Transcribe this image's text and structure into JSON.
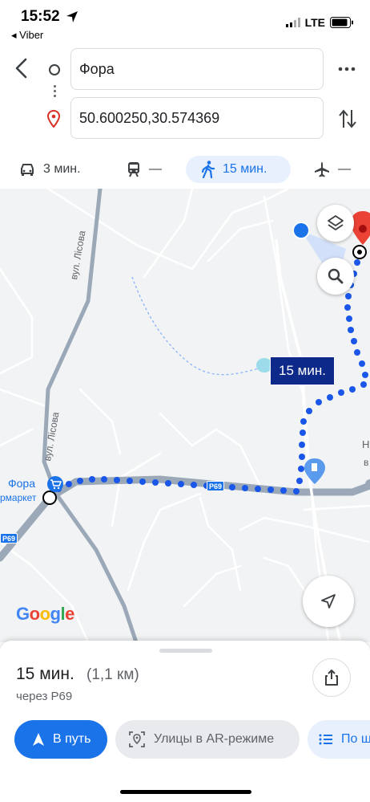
{
  "status_bar": {
    "time": "15:52",
    "back_app": "◂ Viber",
    "network": "LTE"
  },
  "search": {
    "origin": "Фора",
    "destination": "50.600250,30.574369"
  },
  "modes": {
    "car": "3 мин.",
    "transit": "—",
    "walk": "15 мин.",
    "flight": "—"
  },
  "map": {
    "road_labels": [
      "вул. Лісова",
      "вул. Лісова"
    ],
    "route_shield_main": "Р69",
    "route_shield_left": "Р69",
    "poi_name": "Фора",
    "poi_sub": "рмаркет",
    "edge_label_1": "Н",
    "edge_label_2": "в",
    "duration_tag": "15 мин.",
    "brand": "Google",
    "colors": {
      "route": "#1a57e8",
      "road": "#9aa8b8",
      "accent": "#1a73e8"
    }
  },
  "summary": {
    "time": "15 мин.",
    "distance": "(1,1 км)",
    "via": "через Р69"
  },
  "actions": {
    "start": "В путь",
    "ar": "Улицы в AR-режиме",
    "steps": "По ш"
  }
}
